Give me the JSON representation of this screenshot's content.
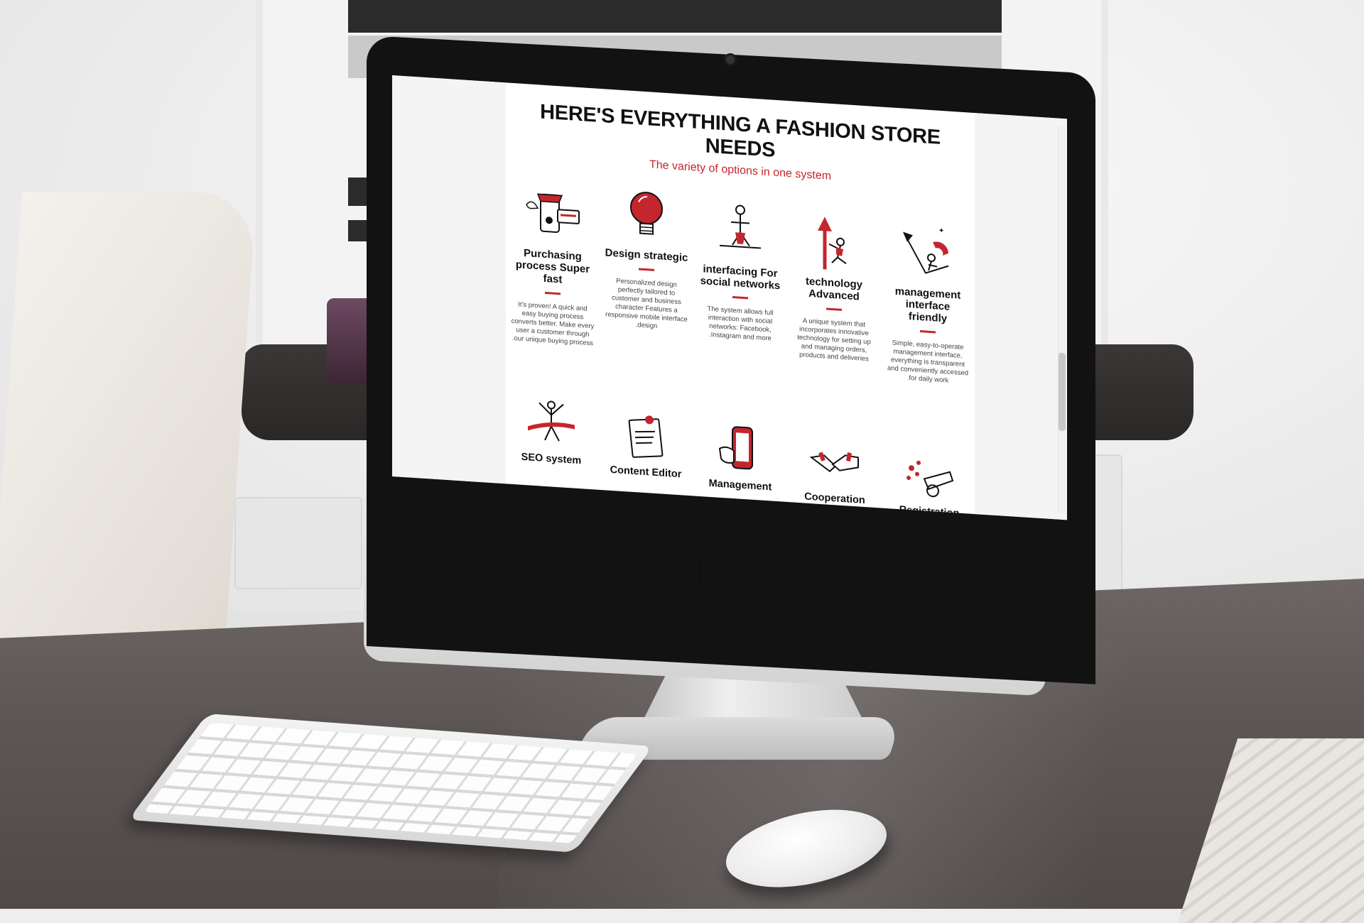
{
  "page": {
    "title": "HERE'S EVERYTHING A FASHION STORE NEEDS",
    "subtitle": "The variety of options in one system"
  },
  "features": [
    {
      "title": "Purchasing process Super fast",
      "description": "It's proven! A quick and easy buying process converts better. Make every user a customer through .our unique buying process",
      "icon": "storefront-phone-icon"
    },
    {
      "title": "Design strategic",
      "description": "Personalized design perfectly tailored to customer and business character Features a responsive mobile interface .design",
      "icon": "lightbulb-icon"
    },
    {
      "title": "interfacing For social networks",
      "description": "The system allows full interaction with social networks: Facebook, .Instagram and more",
      "icon": "person-balancing-icon"
    },
    {
      "title": "technology Advanced",
      "description": "A unique system that incorporates innovative technology for setting up and managing orders, products and deliveries",
      "icon": "climbing-arrow-icon"
    },
    {
      "title": "management interface friendly",
      "description": "Simple, easy-to-operate management interface, everything is transparent and conveniently accessed .for daily work",
      "icon": "growth-chart-icon"
    }
  ],
  "features_row2": [
    {
      "title": "SEO system",
      "icon": "finish-line-icon"
    },
    {
      "title": "Content Editor",
      "icon": "pinned-note-icon"
    },
    {
      "title": "Management",
      "icon": "phone-in-hand-icon"
    },
    {
      "title": "Cooperation",
      "icon": "handshake-icon"
    },
    {
      "title": "Registration",
      "icon": "cannon-icon"
    }
  ],
  "colors": {
    "accent": "#c4262e",
    "text": "#111111"
  }
}
